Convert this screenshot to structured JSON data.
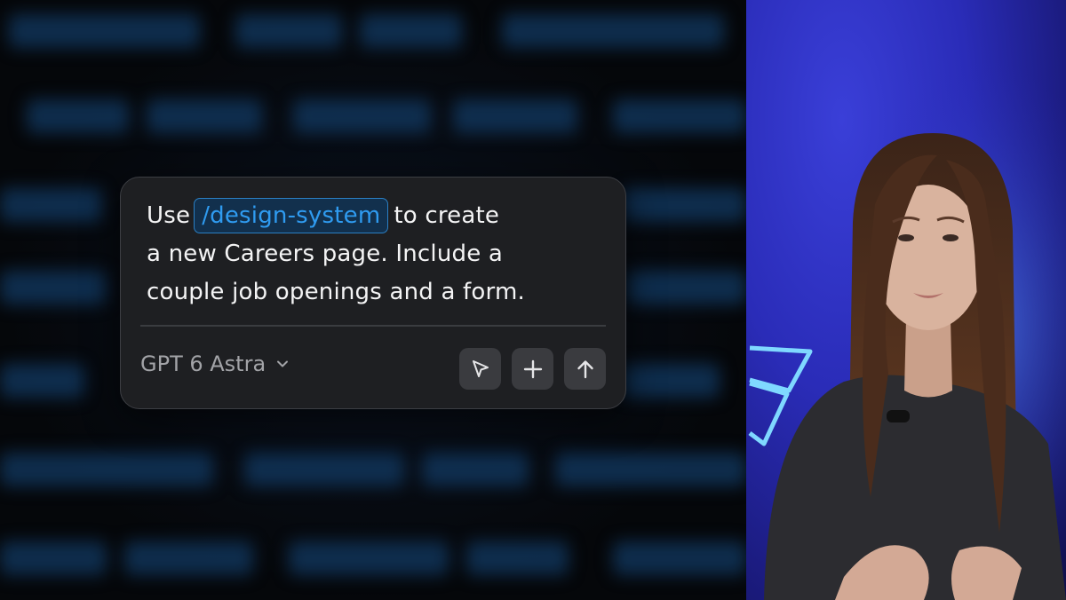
{
  "prompt": {
    "line1_before": "Use",
    "command": "/design-system",
    "line1_after": "to create",
    "line2": "a new Careers page. Include a",
    "line3": "couple job openings and a form."
  },
  "model_selector": {
    "label": "GPT 6 Astra",
    "icon": "chevron-down-icon"
  },
  "actions": [
    {
      "name": "select-tool-button",
      "icon": "cursor-arrow-icon"
    },
    {
      "name": "add-button",
      "icon": "plus-icon"
    },
    {
      "name": "send-button",
      "icon": "arrow-up-icon"
    }
  ],
  "colors": {
    "card_bg": "#1e1f22",
    "command_text": "#2f9bf0",
    "command_bg": "#12304d",
    "camera_bg": "#2a2cb8",
    "neon": "#6fd0ff"
  }
}
